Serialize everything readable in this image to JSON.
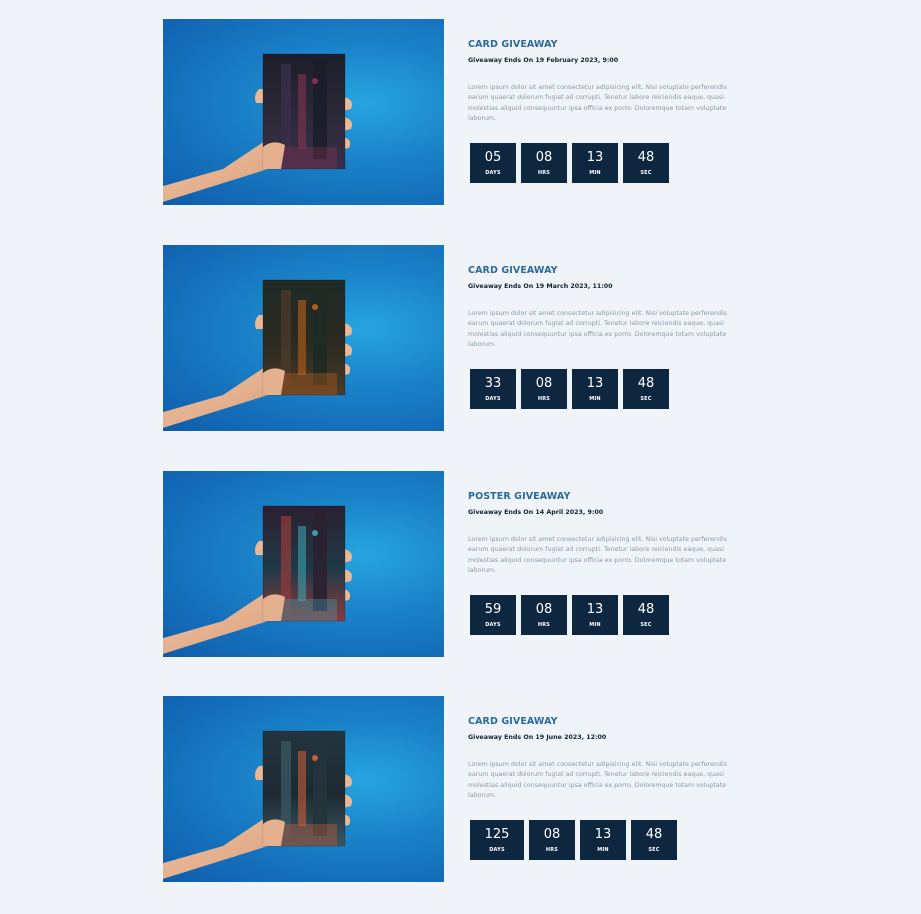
{
  "giveaways": [
    {
      "title": "CARD GIVEAWAY",
      "ends": "Giveaway Ends On 19 February 2023, 9:00",
      "description": "Lorem ipsum dolor sit amet consectetur adipisicing elit. Nisi voluptate perferendis earum quaerat dolorum fugiat ad corrupti. Tenetur labore reiciendis eaque, quasi molestias aliquid consequuntur ipsa officia ex porro. Doloremque totam voluptate laborum.",
      "image": "hand-holding-cyberpunk-city-card",
      "countdown": [
        {
          "value": "05",
          "label": "DAYS"
        },
        {
          "value": "08",
          "label": "HRS"
        },
        {
          "value": "13",
          "label": "MIN"
        },
        {
          "value": "48",
          "label": "SEC"
        }
      ]
    },
    {
      "title": "CARD GIVEAWAY",
      "ends": "Giveaway Ends On 19 March 2023, 11:00",
      "description": "Lorem ipsum dolor sit amet consectetur adipisicing elit. Nisi voluptate perferendis earum quaerat dolorum fugiat ad corrupti. Tenetur labore reiciendis eaque, quasi molestias aliquid consequuntur ipsa officia ex porro. Doloremque totam voluptate laborum.",
      "image": "hand-holding-orange-city-card",
      "countdown": [
        {
          "value": "33",
          "label": "DAYS"
        },
        {
          "value": "08",
          "label": "HRS"
        },
        {
          "value": "13",
          "label": "MIN"
        },
        {
          "value": "48",
          "label": "SEC"
        }
      ]
    },
    {
      "title": "POSTER GIVEAWAY",
      "ends": "Giveaway Ends On 14 April 2023, 9:00",
      "description": "Lorem ipsum dolor sit amet consectetur adipisicing elit. Nisi voluptate perferendis earum quaerat dolorum fugiat ad corrupti. Tenetur labore reiciendis eaque, quasi molestias aliquid consequuntur ipsa officia ex porro. Doloremque totam voluptate laborum.",
      "image": "hand-holding-cloaked-figure-poster",
      "countdown": [
        {
          "value": "59",
          "label": "DAYS"
        },
        {
          "value": "08",
          "label": "HRS"
        },
        {
          "value": "13",
          "label": "MIN"
        },
        {
          "value": "48",
          "label": "SEC"
        }
      ]
    },
    {
      "title": "CARD GIVEAWAY",
      "ends": "Giveaway Ends On 19 June 2023, 12:00",
      "description": "Lorem ipsum dolor sit amet consectetur adipisicing elit. Nisi voluptate perferendis earum quaerat dolorum fugiat ad corrupti. Tenetur labore reiciendis eaque, quasi molestias aliquid consequuntur ipsa officia ex porro. Doloremque totam voluptate laborum.",
      "image": "hand-holding-neon-street-card",
      "countdown": [
        {
          "value": "125",
          "label": "DAYS"
        },
        {
          "value": "08",
          "label": "HRS"
        },
        {
          "value": "13",
          "label": "MIN"
        },
        {
          "value": "48",
          "label": "SEC"
        }
      ]
    }
  ],
  "colors": {
    "background": "#f0f4f8",
    "title": "#2a6a9e",
    "countdown_box": "#0e2741",
    "description": "#8a9aac"
  }
}
